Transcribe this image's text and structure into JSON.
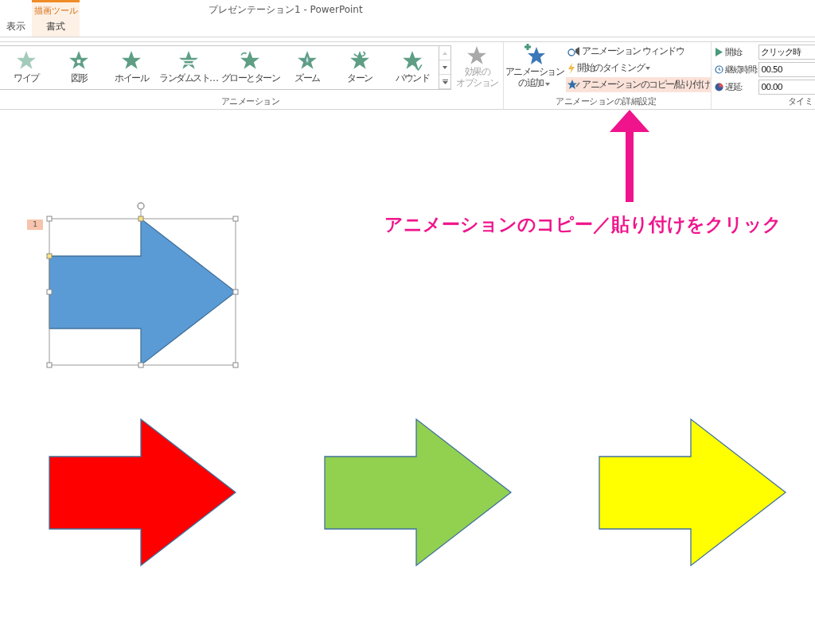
{
  "window": {
    "title": "プレゼンテーション1 - PowerPoint"
  },
  "contextual_group": "描画ツール",
  "tabs": [
    {
      "label": "表示",
      "selected": false,
      "contextual": false
    },
    {
      "label": "書式",
      "selected": false,
      "contextual": true
    }
  ],
  "gallery": {
    "items": [
      {
        "label": "ワイプ",
        "kind": "wipe"
      },
      {
        "label": "図形",
        "kind": "shape"
      },
      {
        "label": "ホイール",
        "kind": "wheel"
      },
      {
        "label": "ランダムスト…",
        "kind": "random"
      },
      {
        "label": "グローとターン",
        "kind": "grow"
      },
      {
        "label": "ズーム",
        "kind": "zoom"
      },
      {
        "label": "ターン",
        "kind": "turn"
      },
      {
        "label": "バウンド",
        "kind": "bounce"
      }
    ],
    "effect_options": {
      "lines": [
        "効果の",
        "オプション"
      ],
      "disabled": true
    },
    "group_label": "アニメーション"
  },
  "advanced": {
    "add_animation": {
      "lines": [
        "アニメーション",
        "の追加"
      ]
    },
    "buttons": [
      {
        "label": "アニメーション ウィンドウ",
        "kind": "pane",
        "highlighted": false,
        "dropdown": false
      },
      {
        "label": "開始のタイミング",
        "kind": "trigger",
        "highlighted": false,
        "dropdown": true
      },
      {
        "label": "アニメーションのコピー/貼り付け",
        "kind": "painter",
        "highlighted": true,
        "dropdown": false
      }
    ],
    "group_label": "アニメーションの詳細設定"
  },
  "timing": {
    "rows": [
      {
        "label": "開始:",
        "value": "クリック時",
        "kind": "start"
      },
      {
        "label": "継続時間:",
        "value": "00.50",
        "kind": "duration"
      },
      {
        "label": "遅延:",
        "value": "00.00",
        "kind": "delay"
      }
    ],
    "group_label": "タイミ"
  },
  "slide": {
    "shapes": [
      {
        "color": "#5b9bd5",
        "selected": true,
        "animation_number": "1"
      },
      {
        "color": "#ff0000",
        "selected": false
      },
      {
        "color": "#92d050",
        "selected": false
      },
      {
        "color": "#ffff00",
        "selected": false
      }
    ],
    "annotation": "アニメーションのコピー／貼り付けをクリック"
  }
}
